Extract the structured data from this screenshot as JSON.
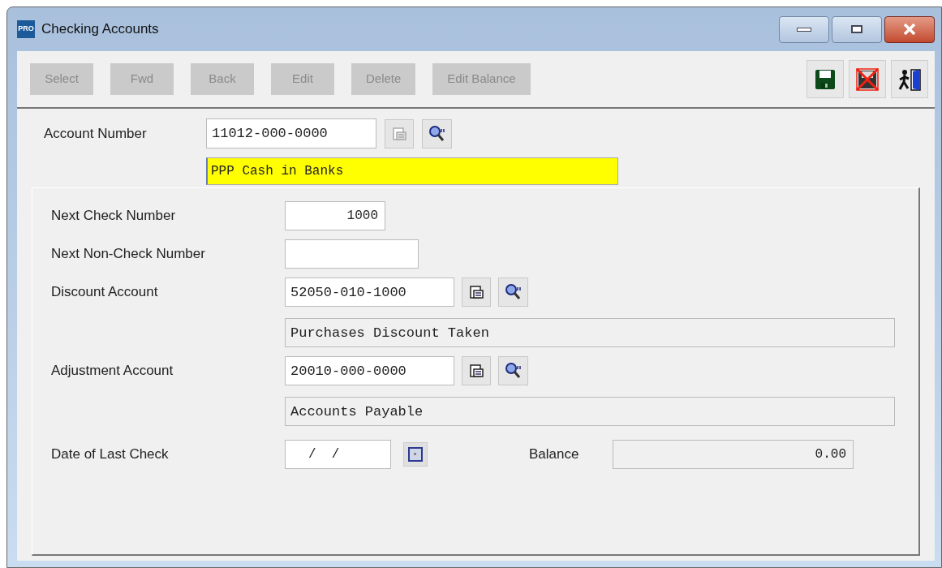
{
  "window": {
    "title": "Checking Accounts",
    "app_badge": "PRO"
  },
  "toolbar": {
    "buttons": [
      {
        "label": "Select",
        "disabled": true
      },
      {
        "label": "Fwd",
        "disabled": true
      },
      {
        "label": "Back",
        "disabled": true
      },
      {
        "label": "Edit",
        "disabled": true
      },
      {
        "label": "Delete",
        "disabled": true
      },
      {
        "label": "Edit Balance",
        "disabled": true
      }
    ]
  },
  "account": {
    "label": "Account Number",
    "value": "11012-000-0000",
    "lookup_disabled": true,
    "description": "PPP Cash in Banks"
  },
  "fields": [
    {
      "kind": "number",
      "label": "Next Check Number",
      "value": "1000"
    },
    {
      "kind": "number",
      "label": "Next Non-Check Number"
    },
    {
      "kind": "account",
      "label": "Discount Account",
      "value": "52050-010-1000",
      "lookup_disabled": false,
      "description": "Purchases Discount Taken"
    },
    {
      "kind": "account",
      "label": "Adjustment Account",
      "value": "20010-000-0000",
      "lookup_disabled": false,
      "description": "Accounts Payable"
    }
  ],
  "date": {
    "label": "Date of Last Check",
    "value": "/  /"
  },
  "balance": {
    "label": "Balance",
    "value": "0.00"
  }
}
